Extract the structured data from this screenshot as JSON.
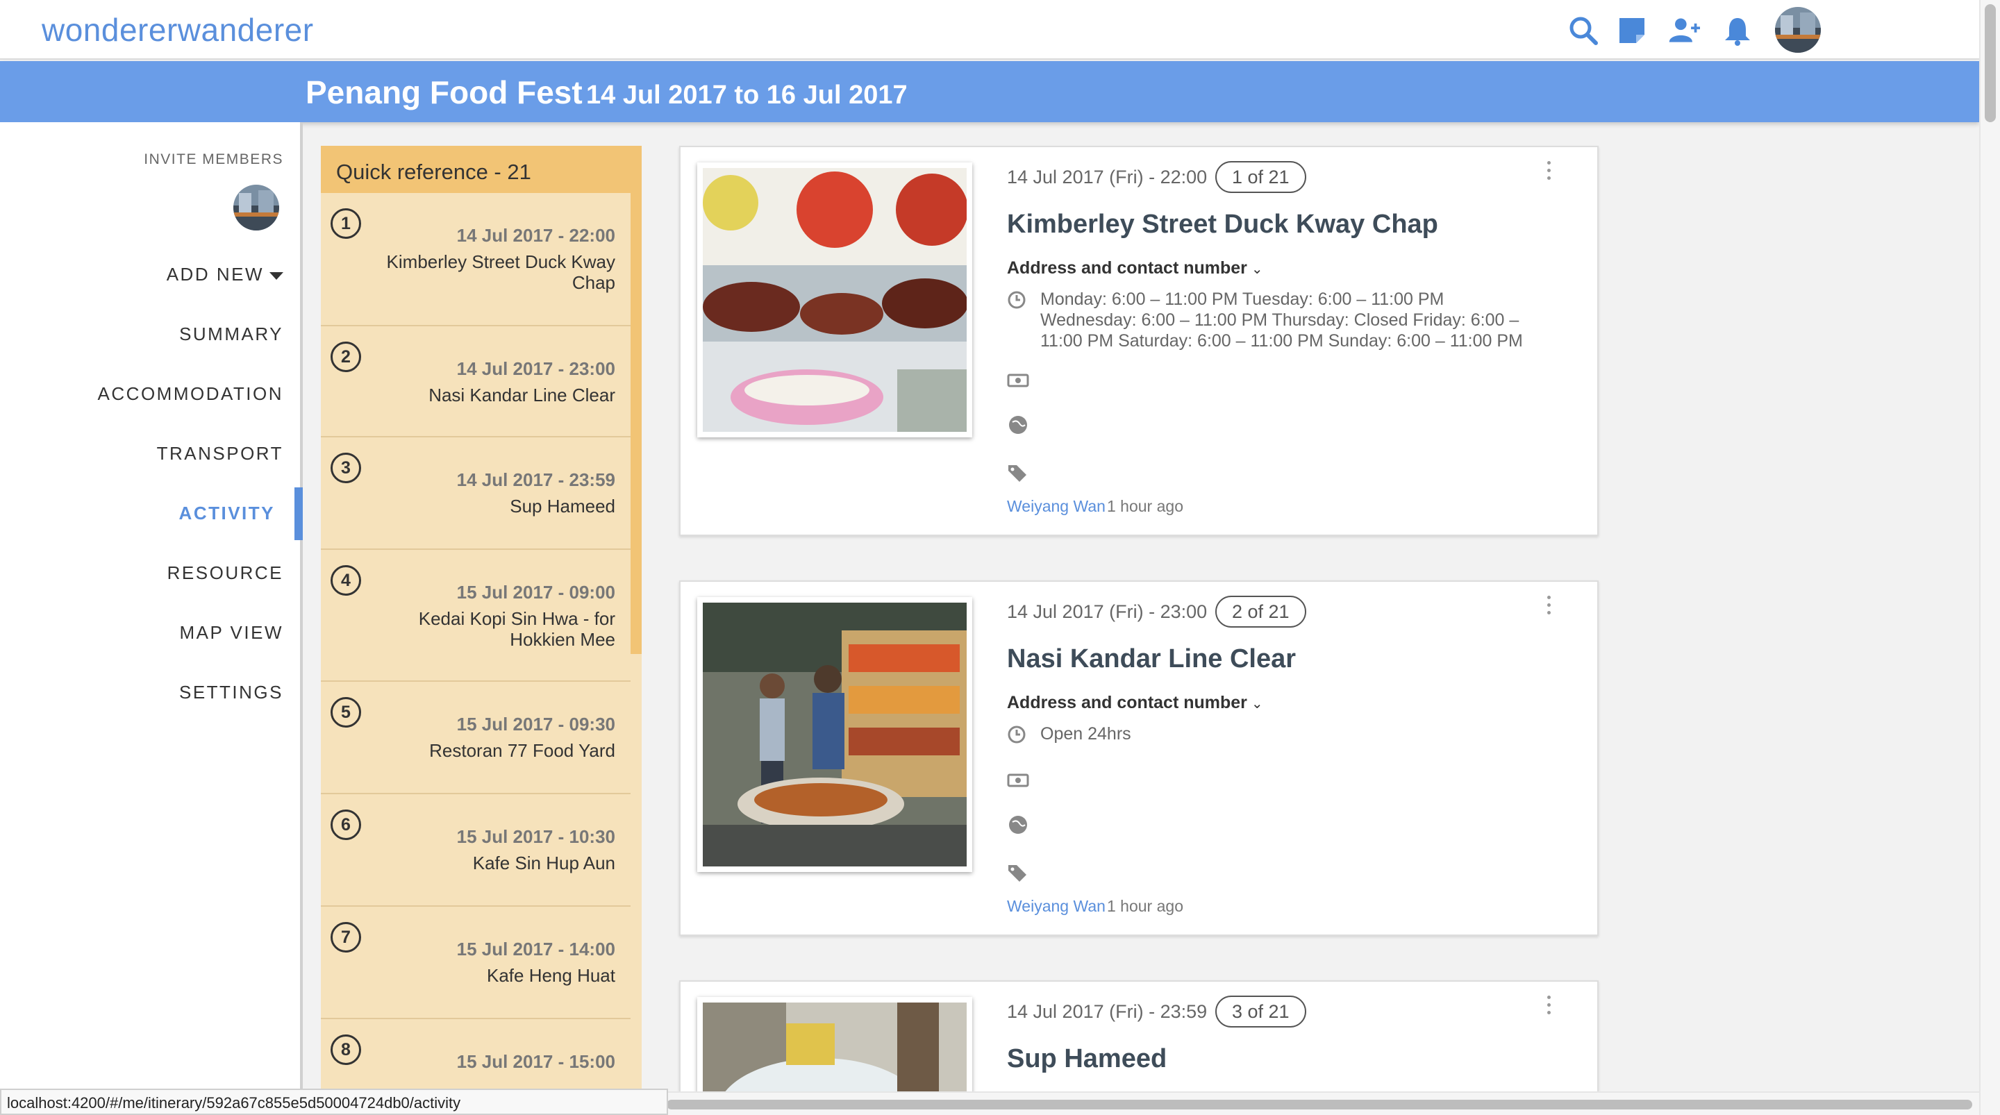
{
  "brand": "wondererwanderer",
  "header_icons": [
    "search-icon",
    "note-icon",
    "add-person-icon",
    "bell-icon"
  ],
  "colors": {
    "accent": "#5a8fdc",
    "header": "#6a9de8",
    "quick_ref_head": "#f2c475",
    "quick_ref_body": "#f6e2bb"
  },
  "trip": {
    "title": "Penang Food Fest",
    "dates": "14 Jul 2017 to 16 Jul 2017"
  },
  "sidebar": {
    "invite_label": "INVITE MEMBERS",
    "add_new": "ADD NEW",
    "items": [
      {
        "label": "SUMMARY",
        "active": false
      },
      {
        "label": "ACCOMMODATION",
        "active": false
      },
      {
        "label": "TRANSPORT",
        "active": false
      },
      {
        "label": "ACTIVITY",
        "active": true
      },
      {
        "label": "RESOURCE",
        "active": false
      },
      {
        "label": "MAP VIEW",
        "active": false
      },
      {
        "label": "SETTINGS",
        "active": false
      }
    ]
  },
  "quick_reference": {
    "title": "Quick reference - 21",
    "items": [
      {
        "num": "1",
        "date": "14 Jul 2017 - 22:00",
        "name": "Kimberley Street Duck Kway Chap"
      },
      {
        "num": "2",
        "date": "14 Jul 2017 - 23:00",
        "name": "Nasi Kandar Line Clear"
      },
      {
        "num": "3",
        "date": "14 Jul 2017 - 23:59",
        "name": "Sup Hameed"
      },
      {
        "num": "4",
        "date": "15 Jul 2017 - 09:00",
        "name": "Kedai Kopi Sin Hwa - for Hokkien Mee"
      },
      {
        "num": "5",
        "date": "15 Jul 2017 - 09:30",
        "name": "Restoran 77 Food Yard"
      },
      {
        "num": "6",
        "date": "15 Jul 2017 - 10:30",
        "name": "Kafe Sin Hup Aun"
      },
      {
        "num": "7",
        "date": "15 Jul 2017 - 14:00",
        "name": "Kafe Heng Huat"
      },
      {
        "num": "8",
        "date": "15 Jul 2017 - 15:00",
        "name": ""
      }
    ]
  },
  "cards": [
    {
      "date": "14 Jul 2017 (Fri) - 22:00",
      "badge": "1 of 21",
      "title": "Kimberley Street Duck Kway Chap",
      "address_label": "Address and contact number",
      "hours": "Monday: 6:00 – 11:00 PM Tuesday: 6:00 – 11:00 PM Wednesday: 6:00 – 11:00 PM Thursday: Closed Friday: 6:00 – 11:00 PM Saturday: 6:00 – 11:00 PM Sunday: 6:00 – 11:00 PM",
      "author": "Weiyang Wan",
      "ago": "1 hour ago"
    },
    {
      "date": "14 Jul 2017 (Fri) - 23:00",
      "badge": "2 of 21",
      "title": "Nasi Kandar Line Clear",
      "address_label": "Address and contact number",
      "hours": "Open 24hrs",
      "author": "Weiyang Wan",
      "ago": "1 hour ago"
    },
    {
      "date": "14 Jul 2017 (Fri) - 23:59",
      "badge": "3 of 21",
      "title": "Sup Hameed"
    }
  ],
  "status_url": "localhost:4200/#/me/itinerary/592a67c855e5d50004724db0/activity"
}
